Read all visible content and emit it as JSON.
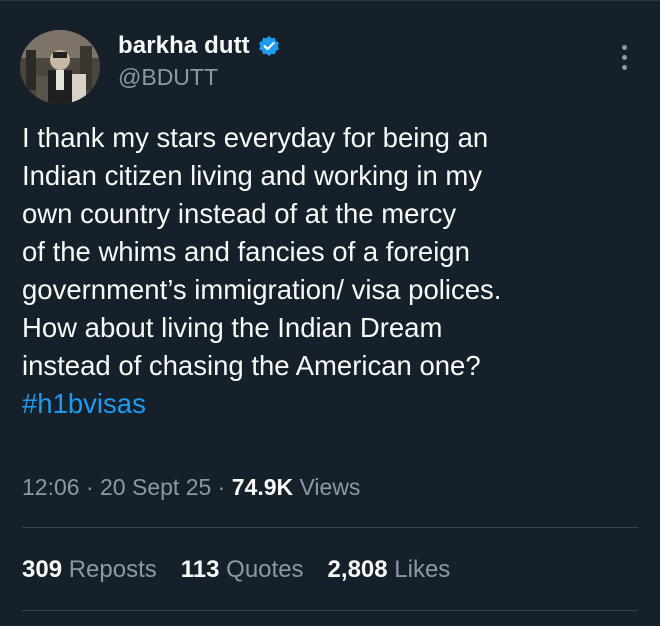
{
  "author": {
    "display_name": "barkha dutt",
    "handle": "@BDUTT",
    "verified": true,
    "verified_color": "#1d9bf0"
  },
  "icons": {
    "verified": "verified-badge-icon",
    "more": "more-vertical-icon"
  },
  "tweet": {
    "lines": [
      "I thank my stars everyday for being an",
      "Indian citizen living and working in my",
      "own country instead of at the mercy",
      "of the whims and fancies of a foreign",
      "government’s immigration/ visa polices.",
      "How about living the Indian Dream",
      "instead of chasing the American one?"
    ],
    "hashtag": "#h1bvisas"
  },
  "meta": {
    "time": "12:06",
    "separator": "·",
    "date": "20 Sept 25",
    "views_count": "74.9K",
    "views_label": "Views"
  },
  "stats": {
    "reposts_count": "309",
    "reposts_label": "Reposts",
    "quotes_count": "113",
    "quotes_label": "Quotes",
    "likes_count": "2,808",
    "likes_label": "Likes"
  },
  "colors": {
    "background": "#15202b",
    "text": "#f7f9f9",
    "muted": "#8b98a5",
    "link": "#1d9bf0",
    "divider": "#38444d"
  }
}
